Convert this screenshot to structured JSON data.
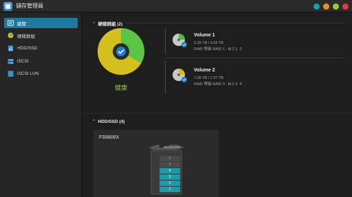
{
  "app": {
    "title": "儲存管理員"
  },
  "window_controls": [
    {
      "name": "teal",
      "color": "#16a3b0"
    },
    {
      "name": "orange",
      "color": "#f08a24"
    },
    {
      "name": "yellow-green",
      "color": "#9ccc32"
    },
    {
      "name": "red",
      "color": "#e23a3a"
    }
  ],
  "sidebar": {
    "items": [
      {
        "label": "總覽",
        "icon": "overview-icon",
        "active": true
      },
      {
        "label": "硬碟群組",
        "icon": "storage-pool-icon",
        "active": false
      },
      {
        "label": "HDD/SSD",
        "icon": "hdd-icon",
        "active": false
      },
      {
        "label": "iSCSI",
        "icon": "iscsi-icon",
        "active": false
      },
      {
        "label": "iSCSI LUN",
        "icon": "iscsi-lun-icon",
        "active": false
      }
    ]
  },
  "storage_pool": {
    "header": "硬碟群組 (2)",
    "status_text": "健康",
    "usage_chart": {
      "volume_1_fraction": 0.333,
      "volume_2_fraction": 0.667,
      "color_1": "#5cc445",
      "color_2": "#d3c01e"
    },
    "volumes": [
      {
        "name": "Volume 1",
        "capacity": "3.39 TB / 3.63 TB",
        "raid": "RAID 等級 RAID 1 : M.2 1, 2",
        "disk_color": "#4fbf3e"
      },
      {
        "name": "Volume 2",
        "capacity": "7.05 TB / 7.27 TB",
        "raid": "RAID 等級 RAID 0 : M.2 3, 4",
        "disk_color": "#d3c01e"
      }
    ]
  },
  "hdd": {
    "header": "HDD/SSD (4)",
    "model": "FS6806X",
    "slots": [
      {
        "label": "6",
        "occupied": false
      },
      {
        "label": "5",
        "occupied": false
      },
      {
        "label": "4",
        "occupied": true
      },
      {
        "label": "3",
        "occupied": true
      },
      {
        "label": "2",
        "occupied": true
      },
      {
        "label": "1",
        "occupied": true
      }
    ]
  }
}
